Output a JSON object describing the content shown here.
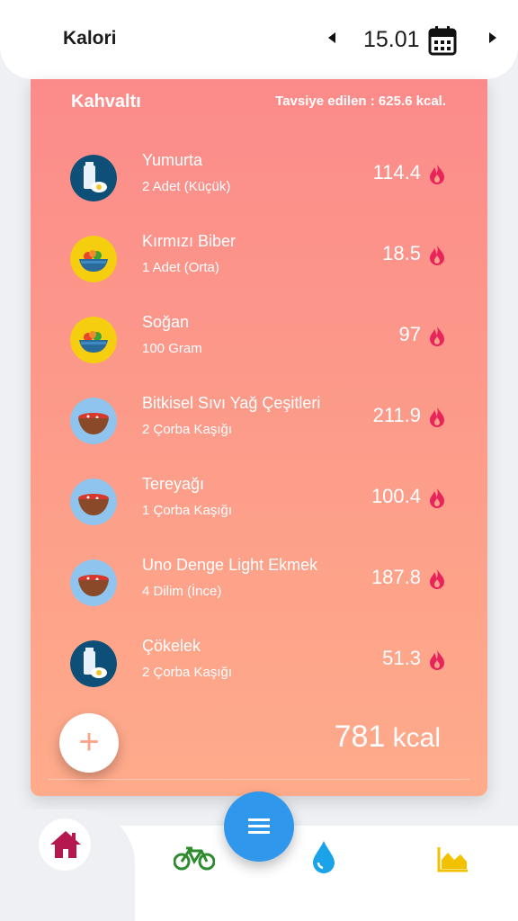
{
  "header": {
    "title": "Kalori",
    "date": "15.01"
  },
  "meal": {
    "title": "Kahvaltı",
    "recommended": "Tavsiye edilen : 625.6 kcal.",
    "items": [
      {
        "name": "Yumurta",
        "portion": "2 Adet (Küçük)",
        "kcal": "114.4",
        "icon": "milk-bottle-icon"
      },
      {
        "name": "Kırmızı Biber",
        "portion": "1 Adet (Orta)",
        "kcal": "18.5",
        "icon": "salad-bowl-icon"
      },
      {
        "name": "Soğan",
        "portion": "100 Gram",
        "kcal": "97",
        "icon": "salad-bowl-icon"
      },
      {
        "name": "Bitkisel Sıvı Yağ Çeşitleri",
        "portion": "2 Çorba Kaşığı",
        "kcal": "211.9",
        "icon": "soup-bowl-icon"
      },
      {
        "name": "Tereyağı",
        "portion": "1 Çorba Kaşığı",
        "kcal": "100.4",
        "icon": "soup-bowl-icon"
      },
      {
        "name": "Uno Denge Light Ekmek",
        "portion": "4 Dilim (İnce)",
        "kcal": "187.8",
        "icon": "soup-bowl-icon"
      },
      {
        "name": "Çökelek",
        "portion": "2 Çorba Kaşığı",
        "kcal": "51.3",
        "icon": "milk-bottle-icon"
      }
    ],
    "total_value": "781",
    "total_unit": "kcal"
  },
  "colors": {
    "card_top": "#fb8b8a",
    "card_bottom": "#ffab8b",
    "flame": "#e8245a",
    "fab": "#2f97ec",
    "home": "#b5174f",
    "bike": "#2e8b2e",
    "water": "#1aa3e8",
    "chart": "#f2c200"
  },
  "nav": [
    "home-icon",
    "bicycle-icon",
    "menu-icon",
    "water-drop-icon",
    "chart-icon"
  ]
}
